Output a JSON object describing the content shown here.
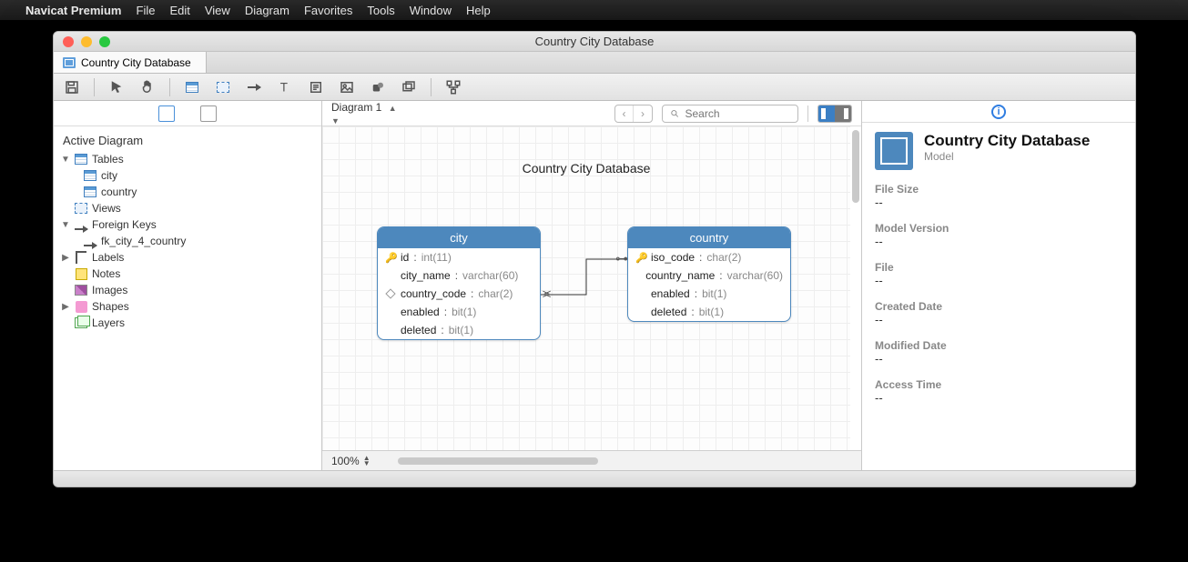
{
  "menubar": {
    "app": "Navicat Premium",
    "items": [
      "File",
      "Edit",
      "View",
      "Diagram",
      "Favorites",
      "Tools",
      "Window",
      "Help"
    ]
  },
  "window": {
    "title": "Country City Database"
  },
  "tab": {
    "label": "Country City Database"
  },
  "canvas_toolbar": {
    "diagram_selector": "Diagram 1",
    "search_placeholder": "Search"
  },
  "sidebar": {
    "heading": "Active Diagram",
    "groups": {
      "tables": {
        "label": "Tables",
        "items": [
          "city",
          "country"
        ]
      },
      "views": {
        "label": "Views"
      },
      "fks": {
        "label": "Foreign Keys",
        "items": [
          "fk_city_4_country"
        ]
      },
      "labels": {
        "label": "Labels"
      },
      "notes": {
        "label": "Notes"
      },
      "images": {
        "label": "Images"
      },
      "shapes": {
        "label": "Shapes"
      },
      "layers": {
        "label": "Layers"
      }
    }
  },
  "canvas": {
    "title": "Country City Database",
    "entities": [
      {
        "name": "city",
        "fields": [
          {
            "icon": "key",
            "name": "id",
            "type": "int(11)"
          },
          {
            "icon": "",
            "name": "city_name",
            "type": "varchar(60)"
          },
          {
            "icon": "fk",
            "name": "country_code",
            "type": "char(2)"
          },
          {
            "icon": "",
            "name": "enabled",
            "type": "bit(1)"
          },
          {
            "icon": "",
            "name": "deleted",
            "type": "bit(1)"
          }
        ]
      },
      {
        "name": "country",
        "fields": [
          {
            "icon": "key",
            "name": "iso_code",
            "type": "char(2)"
          },
          {
            "icon": "",
            "name": "country_name",
            "type": "varchar(60)"
          },
          {
            "icon": "",
            "name": "enabled",
            "type": "bit(1)"
          },
          {
            "icon": "",
            "name": "deleted",
            "type": "bit(1)"
          }
        ]
      }
    ]
  },
  "status": {
    "zoom": "100%"
  },
  "inspector": {
    "title": "Country City Database",
    "subtitle": "Model",
    "props": [
      {
        "label": "File Size",
        "value": "--"
      },
      {
        "label": "Model Version",
        "value": "--"
      },
      {
        "label": "File",
        "value": "--"
      },
      {
        "label": "Created Date",
        "value": "--"
      },
      {
        "label": "Modified Date",
        "value": "--"
      },
      {
        "label": "Access Time",
        "value": "--"
      }
    ]
  }
}
